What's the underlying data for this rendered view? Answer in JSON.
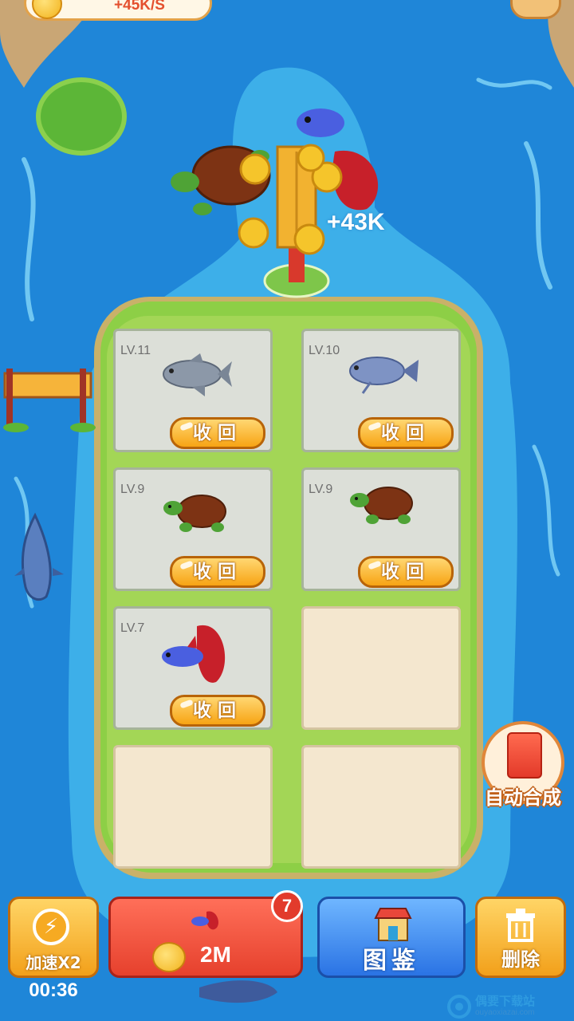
{
  "header": {
    "income_rate": "+45K/S"
  },
  "floating_gain": "+43K",
  "slots": [
    {
      "level": "LV.11",
      "creature": "silver-fish",
      "action": "收回"
    },
    {
      "level": "LV.10",
      "creature": "blue-gourami",
      "action": "收回"
    },
    {
      "level": "LV.9",
      "creature": "turtle",
      "action": "收回"
    },
    {
      "level": "LV.9",
      "creature": "turtle",
      "action": "收回"
    },
    {
      "level": "LV.7",
      "creature": "betta-fish",
      "action": "收回"
    },
    {
      "level": "",
      "creature": "",
      "action": ""
    },
    {
      "level": "",
      "creature": "",
      "action": ""
    },
    {
      "level": "",
      "creature": "",
      "action": ""
    }
  ],
  "side": {
    "auto_merge_label": "自动合成"
  },
  "bottom_bar": {
    "speed": {
      "label": "加速X2",
      "timer": "00:36"
    },
    "buy": {
      "price": "2M",
      "badge_count": "7"
    },
    "atlas": {
      "label": "图鉴"
    },
    "delete": {
      "label": "删除"
    }
  },
  "watermark": {
    "text": "偶要下载站",
    "sub": "ouyaoxiazai.com"
  },
  "colors": {
    "water": "#1f86d8",
    "island_grass": "#8dcf46",
    "button_orange": "#f7a414",
    "button_red": "#e6412d",
    "button_blue": "#2a73e4"
  }
}
